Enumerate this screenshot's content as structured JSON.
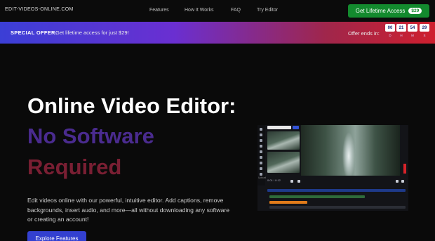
{
  "nav": {
    "logo": "EDIT-VIDEOS-ONLINE.COM",
    "links": [
      "Features",
      "How It Works",
      "FAQ",
      "Try Editor"
    ],
    "cta_label": "Get Lifetime Access",
    "cta_price": "$29"
  },
  "banner": {
    "label": "SPECIAL OFFER:",
    "text": "Get lifetime access for just $29!",
    "ends_label": "Offer ends in:",
    "timer": [
      {
        "value": "00",
        "unit": "D"
      },
      {
        "value": "21",
        "unit": "H"
      },
      {
        "value": "54",
        "unit": "M"
      },
      {
        "value": "29",
        "unit": "S"
      }
    ]
  },
  "hero": {
    "title_line1": "Online Video Editor:",
    "title_line2": "No Software",
    "title_line3": "Required",
    "description": "Edit videos online with our powerful, intuitive editor. Add captions, remove backgrounds, insert audio, and more—all without downloading any software or creating an account!",
    "explore_label": "Explore Features"
  },
  "editor_mock": {
    "timecode": "0:01 / 0:12",
    "side_label": "Upload"
  },
  "colors": {
    "cta_green": "#138a2e",
    "title_purple": "#4a2b8f",
    "title_red": "#7a1f33",
    "explore_blue": "#3340d0",
    "banner_start": "#3b3fd6",
    "banner_end": "#cf1f2e"
  }
}
